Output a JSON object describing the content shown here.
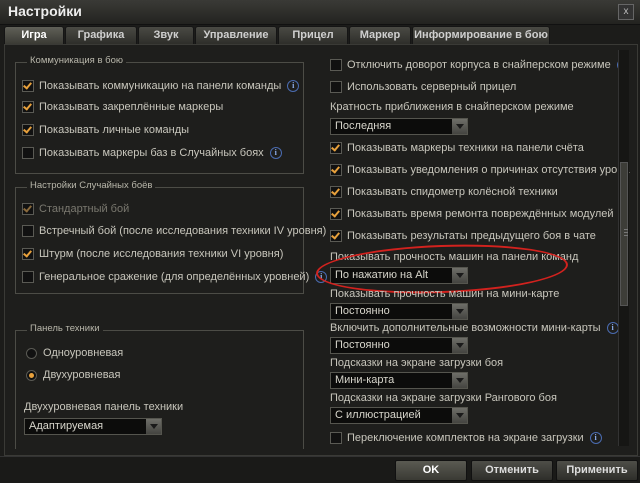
{
  "window": {
    "title": "Настройки",
    "close": "x"
  },
  "tabs": [
    "Игра",
    "Графика",
    "Звук",
    "Управление",
    "Прицел",
    "Маркер",
    "Информирование в бою"
  ],
  "left": {
    "comm_group": "Коммуникация в бою",
    "comm_items": [
      {
        "label": "Показывать коммуникацию на панели команды",
        "checked": true,
        "info": true
      },
      {
        "label": "Показывать закреплённые маркеры",
        "checked": true,
        "info": false
      },
      {
        "label": "Показывать личные команды",
        "checked": true,
        "info": false
      },
      {
        "label": "Показывать маркеры баз в Случайных боях",
        "checked": false,
        "info": true
      }
    ],
    "random_group": "Настройки Случайных боёв",
    "random_items": [
      {
        "label": "Стандартный бой",
        "checked": true,
        "disabled": true
      },
      {
        "label": "Встречный бой (после исследования техники IV уровня)",
        "checked": false
      },
      {
        "label": "Штурм (после исследования техники VI уровня)",
        "checked": true
      },
      {
        "label": "Генеральное сражение (для определённых уровней)",
        "checked": false,
        "info": true
      }
    ],
    "tech_group": "Панель техники",
    "tech_radios": [
      {
        "label": "Одноуровневая",
        "selected": false
      },
      {
        "label": "Двухуровневая",
        "selected": true
      }
    ],
    "two_level_label": "Двухуровневая панель техники",
    "two_level_value": "Адаптируемая"
  },
  "right": {
    "cb_top": [
      {
        "label": "Отключить доворот корпуса в снайперском режиме",
        "checked": false,
        "info": true
      },
      {
        "label": "Использовать серверный прицел",
        "checked": false,
        "info": false
      }
    ],
    "zoom_label": "Кратность приближения в снайперском режиме",
    "zoom_value": "Последняя",
    "cb_mid": [
      {
        "label": "Показывать маркеры техники на панели счёта",
        "checked": true
      },
      {
        "label": "Показывать уведомления о причинах отсутствия урона",
        "checked": true
      },
      {
        "label": "Показывать спидометр колёсной техники",
        "checked": true
      },
      {
        "label": "Показывать время ремонта повреждённых модулей",
        "checked": true
      },
      {
        "label": "Показывать результаты предыдущего боя в чате",
        "checked": true
      }
    ],
    "hp_panel_label": "Показывать прочность машин на панели команд",
    "hp_panel_value": "По нажатию на Alt",
    "hp_minimap_label": "Показывать прочность машин на мини-карте",
    "hp_minimap_value": "Постоянно",
    "minimap_extra_label": "Включить дополнительные возможности мини-карты",
    "minimap_extra_value": "Постоянно",
    "loading_hints_label": "Подсказки на экране загрузки боя",
    "loading_hints_value": "Мини-карта",
    "ranked_hints_label": "Подсказки на экране загрузки Рангового боя",
    "ranked_hints_value": "С иллюстрацией",
    "switch_kits": {
      "label": "Переключение комплектов на экране загрузки",
      "checked": false
    }
  },
  "info_glyph": "i",
  "footer": {
    "ok": "OK",
    "cancel": "Отменить",
    "apply": "Применить"
  },
  "colors": {
    "accent": "#e8a13c",
    "highlight": "#d2221e",
    "info": "#4a6bb0"
  }
}
